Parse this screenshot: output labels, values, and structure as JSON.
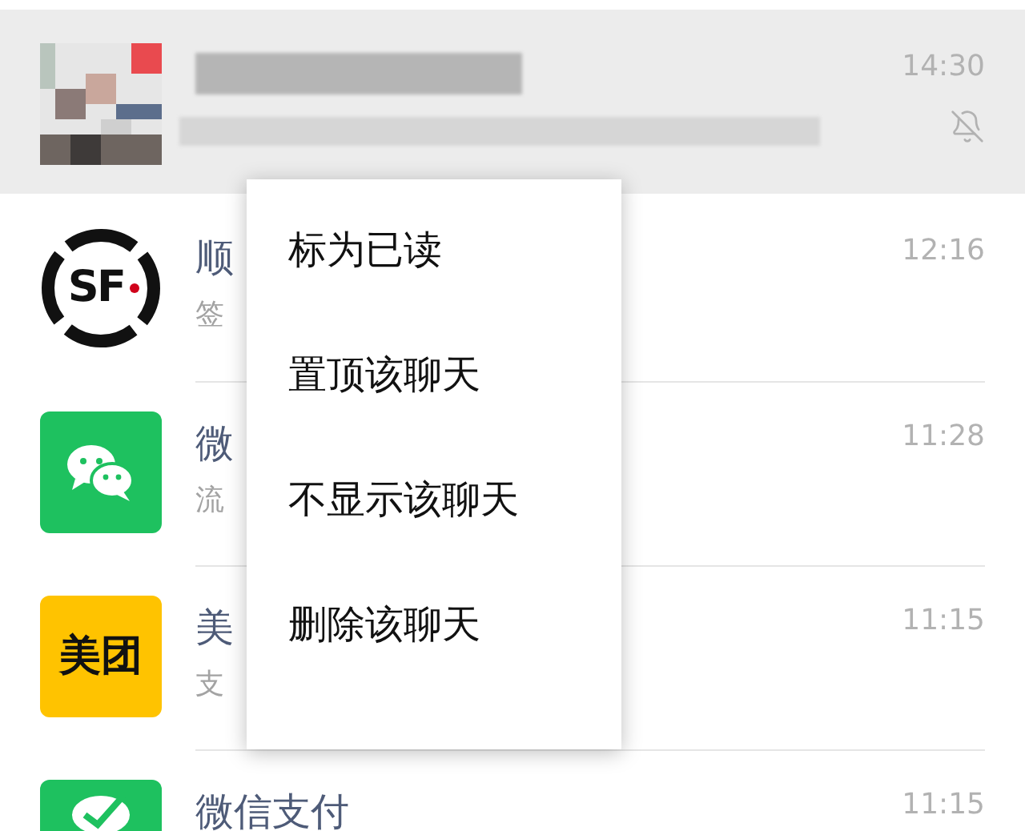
{
  "chats": [
    {
      "kind": "blurred",
      "time": "14:30",
      "muted": true,
      "selected": true
    },
    {
      "kind": "normal",
      "avatar": {
        "kind": "sf",
        "logo_text": "SF"
      },
      "name": "顺",
      "preview": "签",
      "time": "12:16",
      "muted": false,
      "selected": false
    },
    {
      "kind": "normal",
      "avatar": {
        "kind": "wechat"
      },
      "name": "微",
      "preview": "流",
      "time": "11:28",
      "muted": false,
      "selected": false
    },
    {
      "kind": "normal",
      "avatar": {
        "kind": "meituan",
        "logo_text": "美团"
      },
      "name": "美",
      "preview": "支",
      "time": "11:15",
      "muted": false,
      "selected": false
    },
    {
      "kind": "normal",
      "avatar": {
        "kind": "pay"
      },
      "name": "微信支付",
      "time": "11:15",
      "muted": false,
      "selected": false
    }
  ],
  "context_menu": {
    "items": [
      "标为已读",
      "置顶该聊天",
      "不显示该聊天",
      "删除该聊天"
    ]
  }
}
